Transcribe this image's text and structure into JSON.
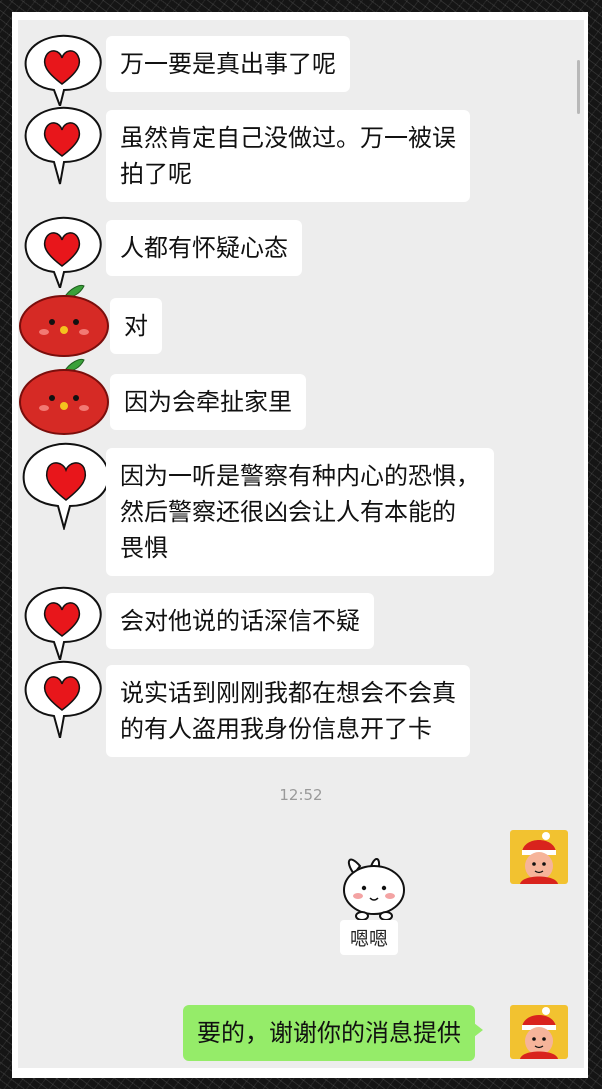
{
  "messages": [
    {
      "side": "other",
      "avatar": "heart-icon",
      "text": "万一要是真出事了呢"
    },
    {
      "side": "other",
      "avatar": "heart-icon",
      "text": "虽然肯定自己没做过。万一被误\n拍了呢"
    },
    {
      "side": "other",
      "avatar": "heart-icon",
      "text": "人都有怀疑心态"
    },
    {
      "side": "other",
      "avatar": "apple-face-icon",
      "text": "对"
    },
    {
      "side": "other",
      "avatar": "apple-face-icon",
      "text": "因为会牵扯家里"
    },
    {
      "side": "other",
      "avatar": "heart-icon",
      "text": "因为一听是警察有种内心的恐惧，\n然后警察还很凶会让人有本能的\n畏惧"
    },
    {
      "side": "other",
      "avatar": "heart-icon",
      "text": "会对他说的话深信不疑"
    },
    {
      "side": "other",
      "avatar": "heart-icon",
      "text": "说实话到刚刚我都在想会不会真\n的有人盗用我身份信息开了卡"
    }
  ],
  "timestamp": "12:52",
  "sticker": {
    "icon": "bunny-icon",
    "caption": "嗯嗯"
  },
  "my_message": {
    "text": "要的，谢谢你的消息提供",
    "avatar": "red-hat-kid-icon"
  },
  "colors": {
    "chat_bg": "#ededed",
    "my_bubble": "#95ec69",
    "other_bubble": "#ffffff",
    "heart": "#e8161b",
    "apple": "#d62a25"
  }
}
